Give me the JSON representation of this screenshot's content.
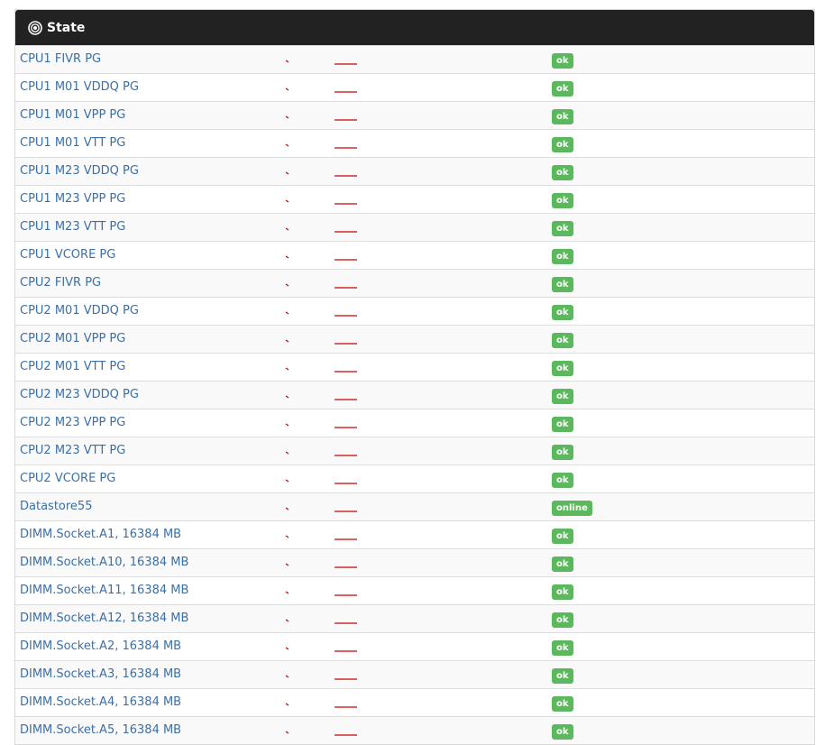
{
  "header": {
    "title": "State",
    "icon": "record-icon"
  },
  "colors": {
    "header_bg": "#222222",
    "link": "#3b6fa6",
    "badge_ok": "#5cb85c",
    "spark": "#cc0000"
  },
  "rows": [
    {
      "name": "CPU1 FIVR PG",
      "status": "ok"
    },
    {
      "name": "CPU1 M01 VDDQ PG",
      "status": "ok"
    },
    {
      "name": "CPU1 M01 VPP PG",
      "status": "ok"
    },
    {
      "name": "CPU1 M01 VTT PG",
      "status": "ok"
    },
    {
      "name": "CPU1 M23 VDDQ PG",
      "status": "ok"
    },
    {
      "name": "CPU1 M23 VPP PG",
      "status": "ok"
    },
    {
      "name": "CPU1 M23 VTT PG",
      "status": "ok"
    },
    {
      "name": "CPU1 VCORE PG",
      "status": "ok"
    },
    {
      "name": "CPU2 FIVR PG",
      "status": "ok"
    },
    {
      "name": "CPU2 M01 VDDQ PG",
      "status": "ok"
    },
    {
      "name": "CPU2 M01 VPP PG",
      "status": "ok"
    },
    {
      "name": "CPU2 M01 VTT PG",
      "status": "ok"
    },
    {
      "name": "CPU2 M23 VDDQ PG",
      "status": "ok"
    },
    {
      "name": "CPU2 M23 VPP PG",
      "status": "ok"
    },
    {
      "name": "CPU2 M23 VTT PG",
      "status": "ok"
    },
    {
      "name": "CPU2 VCORE PG",
      "status": "ok"
    },
    {
      "name": "Datastore55",
      "status": "online"
    },
    {
      "name": "DIMM.Socket.A1, 16384 MB",
      "status": "ok"
    },
    {
      "name": "DIMM.Socket.A10, 16384 MB",
      "status": "ok"
    },
    {
      "name": "DIMM.Socket.A11, 16384 MB",
      "status": "ok"
    },
    {
      "name": "DIMM.Socket.A12, 16384 MB",
      "status": "ok"
    },
    {
      "name": "DIMM.Socket.A2, 16384 MB",
      "status": "ok"
    },
    {
      "name": "DIMM.Socket.A3, 16384 MB",
      "status": "ok"
    },
    {
      "name": "DIMM.Socket.A4, 16384 MB",
      "status": "ok"
    },
    {
      "name": "DIMM.Socket.A5, 16384 MB",
      "status": "ok"
    }
  ]
}
